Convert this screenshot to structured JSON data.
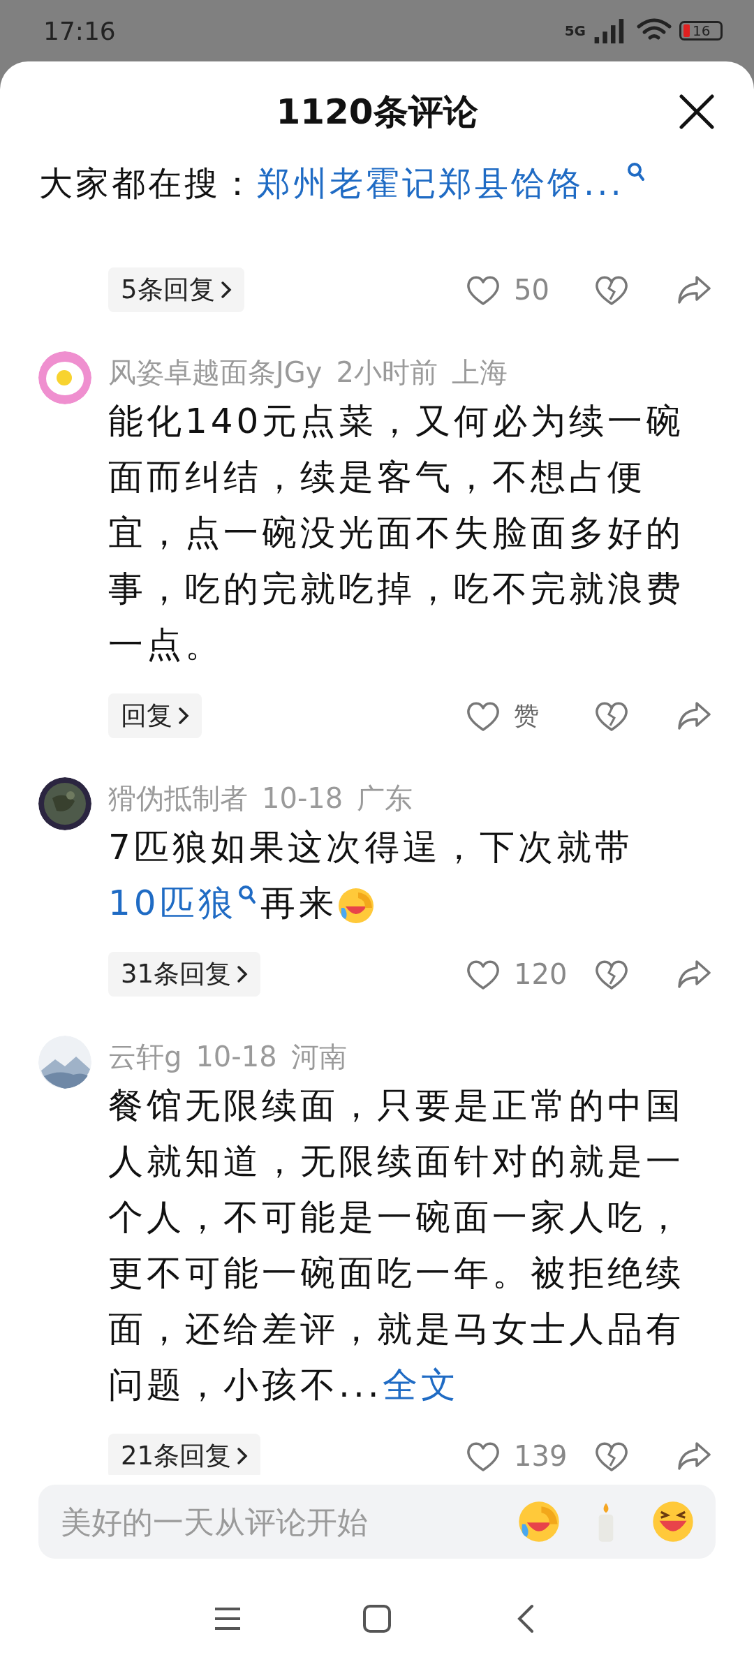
{
  "status_bar": {
    "time": "17:16",
    "network": "5G",
    "battery": "16"
  },
  "header": {
    "title": "1120条评论"
  },
  "trending": {
    "label": "大家都在搜：",
    "query": "郑州老霍记郑县饸饹..."
  },
  "comments": [
    {
      "kind": "partial",
      "replies": "5条回复",
      "likes": "50"
    },
    {
      "kind": "full",
      "author": "风姿卓越面条JGy",
      "time": "2小时前",
      "location": "上海",
      "body": [
        {
          "kind": "text",
          "text": "能化140元点菜，又何必为续一碗面而纠结，续是客气，不想占便宜，点一碗没光面不失脸面多好的事，吃的完就吃掉，吃不完就浪费一点。"
        }
      ],
      "replies": "回复",
      "likes": "赞"
    },
    {
      "kind": "full",
      "author": "猾伪抵制者",
      "time": "10-18",
      "location": "广东",
      "body": [
        {
          "kind": "text",
          "text": "7匹狼如果这次得逞，下次就带"
        },
        {
          "kind": "search",
          "text": "10匹狼"
        },
        {
          "kind": "text",
          "text": "再来"
        },
        {
          "kind": "emoji"
        }
      ],
      "replies": "31条回复",
      "likes": "120"
    },
    {
      "kind": "full",
      "author": "云轩g",
      "time": "10-18",
      "location": "河南",
      "body": [
        {
          "kind": "text",
          "text": "餐馆无限续面，只要是正常的中国人就知道，无限续面针对的就是一个人，不可能是一碗面一家人吃，更不可能一碗面吃一年。被拒绝续面，还给差评，就是马女士人品有问题，小孩不..."
        },
        {
          "kind": "more",
          "text": "全文"
        }
      ],
      "replies": "21条回复",
      "likes": "139"
    }
  ],
  "composer": {
    "placeholder": "美好的一天从评论开始"
  }
}
